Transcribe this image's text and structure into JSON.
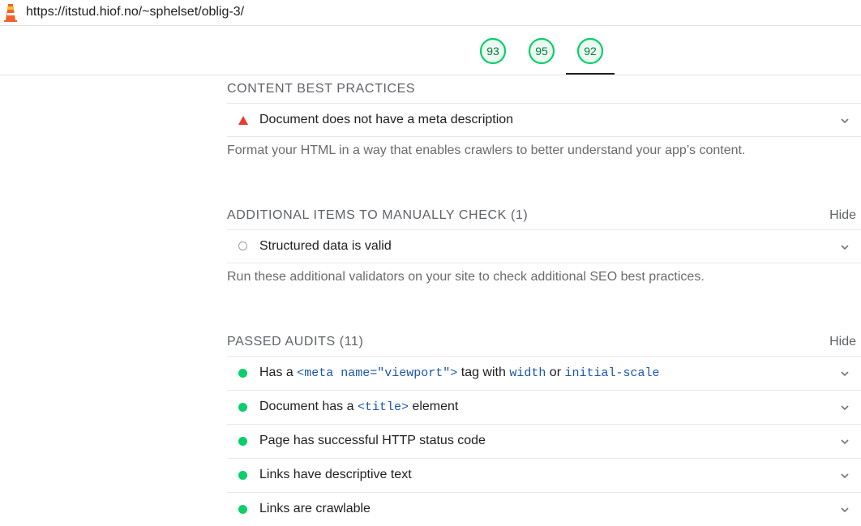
{
  "browser": {
    "url": "https://itstud.hiof.no/~sphelset/oblig-3/"
  },
  "gauges": [
    {
      "score": "93"
    },
    {
      "score": "95"
    },
    {
      "score": "92"
    }
  ],
  "sections": {
    "content_best_practices": {
      "title": "CONTENT BEST PRACTICES",
      "audits": [
        {
          "title": "Document does not have a meta description"
        }
      ],
      "description": "Format your HTML in a way that enables crawlers to better understand your app’s content."
    },
    "manual": {
      "title": "ADDITIONAL ITEMS TO MANUALLY CHECK (1)",
      "hide_label": "Hide",
      "audits": [
        {
          "title": "Structured data is valid"
        }
      ],
      "description": "Run these additional validators on your site to check additional SEO best practices."
    },
    "passed": {
      "title": "PASSED AUDITS (11)",
      "hide_label": "Hide",
      "audits": [
        {
          "t1": "Has a ",
          "c1": "<meta name=\"viewport\">",
          "t2": " tag with ",
          "c2": "width",
          "t3": " or ",
          "c3": "initial-scale"
        },
        {
          "t1": "Document has a ",
          "c1": "<title>",
          "t2": " element"
        },
        {
          "title": "Page has successful HTTP status code"
        },
        {
          "title": "Links have descriptive text"
        },
        {
          "title": "Links are crawlable"
        }
      ]
    }
  },
  "colors": {
    "pass": "#0cce6b",
    "fail": "#eb3b2f",
    "manual": "#9e9e9e"
  },
  "icons": {
    "logo": "lighthouse-logo-icon",
    "expand": "chevron-down-icon"
  }
}
